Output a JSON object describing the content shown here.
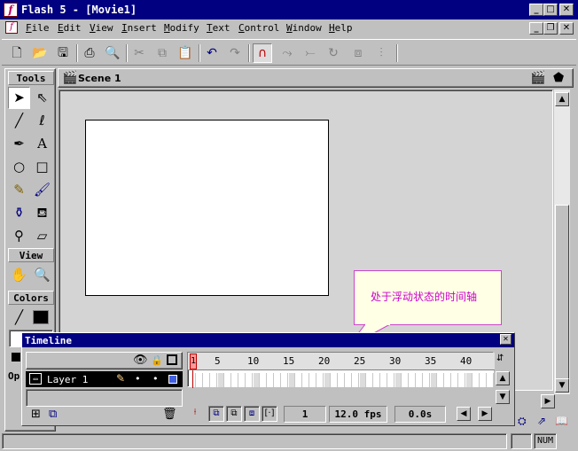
{
  "window": {
    "title": "Flash 5 - [Movie1]",
    "icon": "flash-app-icon"
  },
  "menu": [
    {
      "key": "F",
      "rest": "ile"
    },
    {
      "key": "E",
      "rest": "dit"
    },
    {
      "key": "V",
      "rest": "iew"
    },
    {
      "key": "I",
      "rest": "nsert"
    },
    {
      "key": "M",
      "rest": "odify"
    },
    {
      "key": "T",
      "rest": "ext"
    },
    {
      "key": "C",
      "rest": "ontrol"
    },
    {
      "key": "W",
      "rest": "indow"
    },
    {
      "key": "H",
      "rest": "elp"
    }
  ],
  "toolbar_icons": [
    "new-file-icon",
    "open-folder-icon",
    "save-icon",
    "print-icon",
    "print-preview-icon",
    "cut-icon",
    "copy-icon",
    "paste-icon",
    "undo-icon",
    "redo-icon",
    "snap-to-objects-icon",
    "smooth-icon",
    "straighten-icon",
    "rotate-icon",
    "scale-icon",
    "align-icon"
  ],
  "tools": {
    "header": "Tools",
    "view_header": "View",
    "colors_header": "Colors",
    "options_header": "Op"
  },
  "scene": {
    "label": "Scene 1"
  },
  "callout": {
    "text": "处于浮动状态的时间轴"
  },
  "timeline": {
    "title": "Timeline",
    "layer_name": "Layer 1",
    "frame_numbers": [
      "1",
      "5",
      "10",
      "15",
      "20",
      "25",
      "30",
      "35",
      "40"
    ],
    "current_frame": "1",
    "frame_rate": "12.0 fps",
    "elapsed_time": "0.0s"
  },
  "status": {
    "num": "NUM"
  },
  "colors": {
    "title_bar": "#000080",
    "callout_text": "#cc00cc",
    "playhead": "#ff9a9a"
  }
}
